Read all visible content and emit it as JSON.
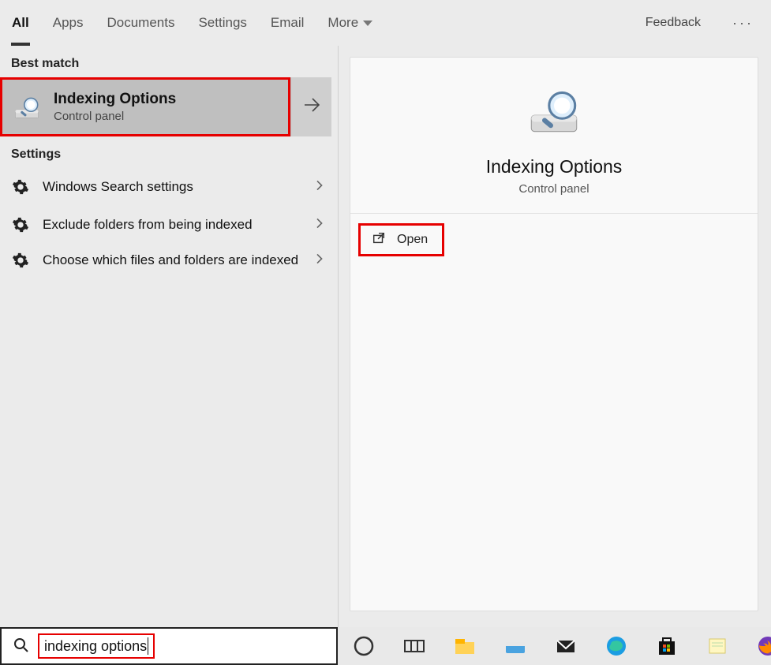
{
  "tabs": {
    "all": "All",
    "apps": "Apps",
    "documents": "Documents",
    "settings": "Settings",
    "email": "Email",
    "more": "More",
    "feedback": "Feedback"
  },
  "sections": {
    "best_match": "Best match",
    "settings": "Settings"
  },
  "best_match": {
    "title": "Indexing Options",
    "subtitle": "Control panel"
  },
  "settings_items": [
    {
      "label": "Windows Search settings"
    },
    {
      "label": "Exclude folders from being indexed"
    },
    {
      "label": "Choose which files and folders are indexed"
    }
  ],
  "details": {
    "title": "Indexing Options",
    "subtitle": "Control panel",
    "actions": {
      "open": "Open"
    }
  },
  "search": {
    "query": "indexing options"
  }
}
